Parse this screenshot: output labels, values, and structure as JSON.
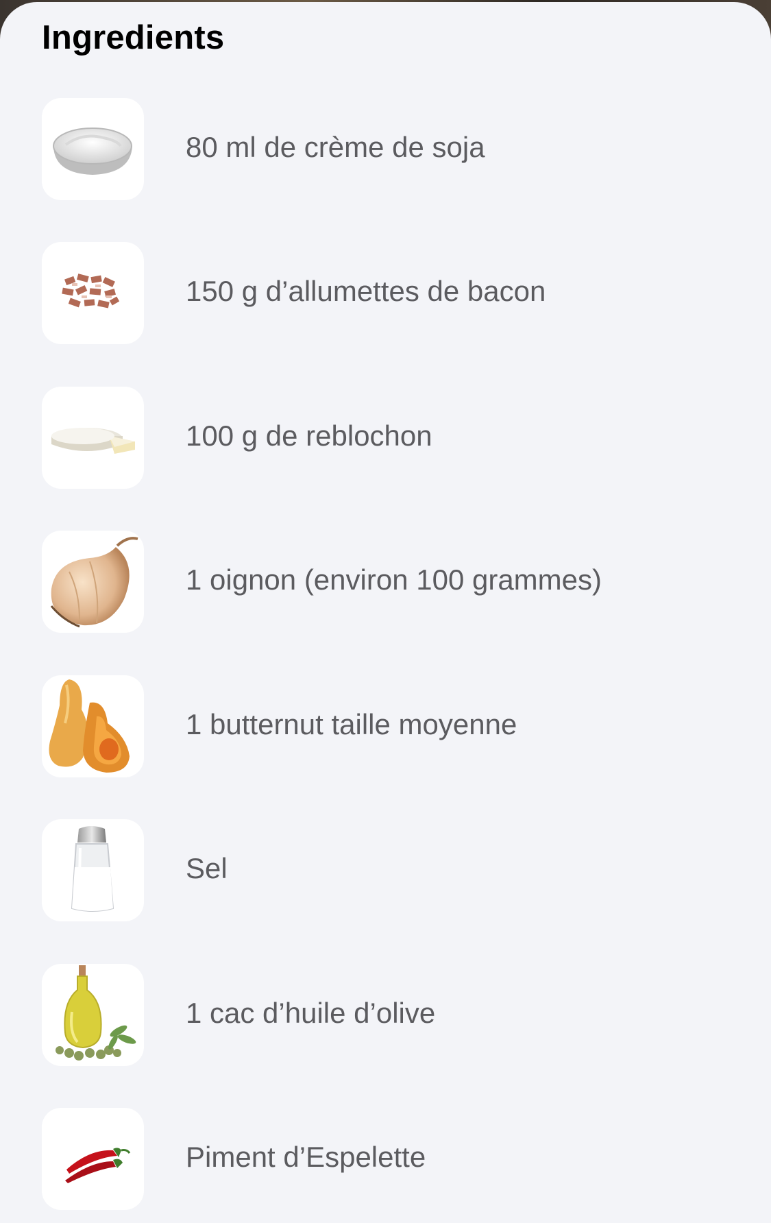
{
  "header": {
    "title": "Ingredients"
  },
  "ingredients": [
    {
      "label": "80 ml de crème de soja",
      "icon": "cream-bowl-icon"
    },
    {
      "label": "150 g d’allumettes de bacon",
      "icon": "bacon-icon"
    },
    {
      "label": "100 g de reblochon",
      "icon": "cheese-icon"
    },
    {
      "label": "1 oignon (environ 100 grammes)",
      "icon": "onion-icon"
    },
    {
      "label": "1 butternut taille moyenne",
      "icon": "butternut-icon"
    },
    {
      "label": "Sel",
      "icon": "salt-shaker-icon"
    },
    {
      "label": "1 cac d’huile d’olive",
      "icon": "olive-oil-icon"
    },
    {
      "label": "Piment d’Espelette",
      "icon": "chili-pepper-icon"
    }
  ],
  "colors": {
    "background": "#f3f4f8",
    "text": "#5b5b5f",
    "title": "#000000",
    "thumb": "#ffffff"
  }
}
